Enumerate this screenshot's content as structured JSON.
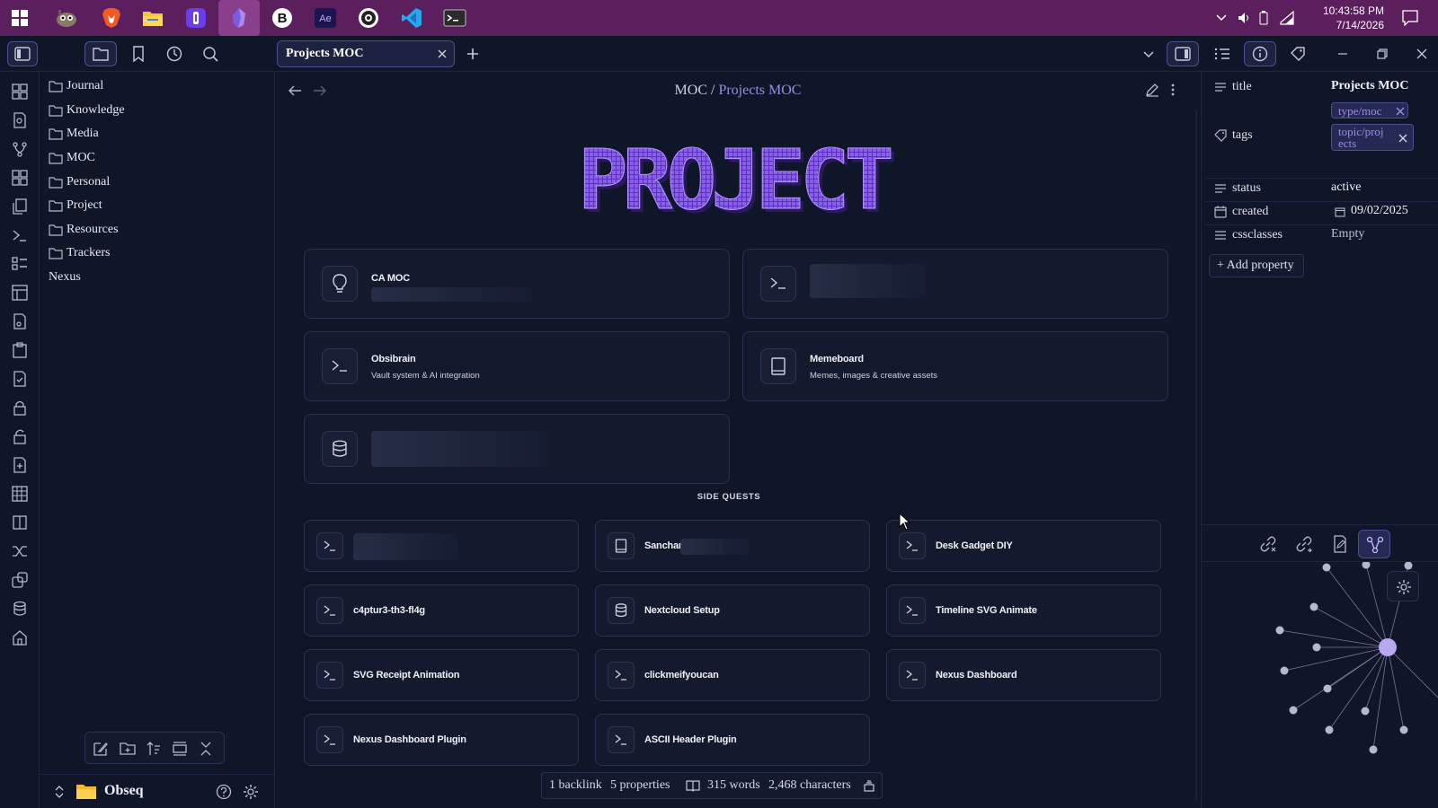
{
  "taskbar": {
    "apps": [
      "start-icon",
      "gimp-icon",
      "brave-icon",
      "file-explorer-icon",
      "app-icon",
      "obsidian-icon",
      "bitwarden-icon",
      "after-effects-icon",
      "obs-icon",
      "vscode-icon",
      "terminal-icon"
    ],
    "clock_time": "10:43:58 PM",
    "clock_date": "7/14/2026"
  },
  "tab": {
    "title": "Projects MOC"
  },
  "explorer": {
    "folders": [
      "Journal",
      "Knowledge",
      "Media",
      "MOC",
      "Personal",
      "Project",
      "Resources",
      "Trackers"
    ],
    "files": [
      "Nexus"
    ],
    "vault_name": "Obseq"
  },
  "breadcrumb": {
    "parent": "MOC",
    "separator": " / ",
    "current": "Projects MOC"
  },
  "banner": {
    "text": "PROJECT"
  },
  "main_cards": [
    {
      "icon": "lightbulb-icon",
      "title": "CA MOC",
      "subtitle": ""
    },
    {
      "icon": "terminal-icon",
      "title": "",
      "subtitle": ""
    },
    {
      "icon": "terminal-icon",
      "title": "Obsibrain",
      "subtitle": "Vault system & AI integration"
    },
    {
      "icon": "book-icon",
      "title": "Memeboard",
      "subtitle": "Memes, images & creative assets"
    },
    {
      "icon": "database-icon",
      "title": "",
      "subtitle": ""
    }
  ],
  "side_quests_label": "SIDE QUESTS",
  "side_quests": [
    {
      "icon": "terminal-icon",
      "title": ""
    },
    {
      "icon": "book-icon",
      "title": "Sanchar"
    },
    {
      "icon": "terminal-icon",
      "title": "Desk Gadget DIY"
    },
    {
      "icon": "terminal-icon",
      "title": "c4ptur3-th3-fl4g"
    },
    {
      "icon": "database-icon",
      "title": "Nextcloud Setup"
    },
    {
      "icon": "terminal-icon",
      "title": "Timeline SVG Animate"
    },
    {
      "icon": "terminal-icon",
      "title": "SVG Receipt Animation"
    },
    {
      "icon": "terminal-icon",
      "title": "clickmeifyoucan"
    },
    {
      "icon": "terminal-icon",
      "title": "Nexus Dashboard"
    },
    {
      "icon": "terminal-icon",
      "title": "Nexus Dashboard Plugin"
    },
    {
      "icon": "terminal-icon",
      "title": "ASCII Header Plugin"
    }
  ],
  "status": {
    "backlinks": "1 backlink",
    "properties": "5 properties",
    "words": "315 words",
    "characters": "2,468 characters"
  },
  "properties": {
    "title_key": "title",
    "title_value": "Projects MOC",
    "tags_key": "tags",
    "tag1": "type/moc",
    "tag2_line1": "topic/proj",
    "tag2_line2": "ects",
    "status_key": "status",
    "status_value": "active",
    "created_key": "created",
    "created_value": "09/02/2025",
    "cssclasses_key": "cssclasses",
    "cssclasses_value": "Empty",
    "add_label": "Add property"
  },
  "colors": {
    "accent": "#8a5cf0",
    "taskbar": "#5b1f5e",
    "background": "#0f1628"
  }
}
